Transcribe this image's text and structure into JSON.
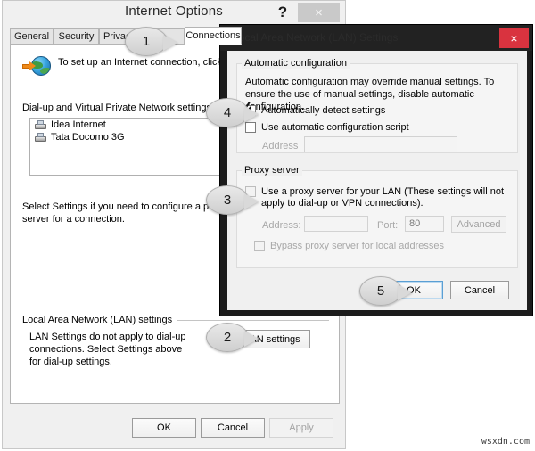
{
  "internet_options": {
    "title": "Internet Options",
    "help_icon": "?",
    "close_icon": "×",
    "tabs": [
      {
        "label": "General",
        "selected": false
      },
      {
        "label": "Security",
        "selected": false
      },
      {
        "label": "Privacy",
        "selected": false
      },
      {
        "label": "•",
        "selected": false
      },
      {
        "label": "Connections",
        "selected": true
      }
    ],
    "setup_text": "To set up an Internet connection, click Setup.",
    "dialup_group_label": "Dial-up and Virtual Private Network settings",
    "dialup_items": [
      {
        "label": "Idea Internet"
      },
      {
        "label": "Tata Docomo 3G"
      }
    ],
    "settings_hint": "Select Settings if you need to configure a proxy server for a connection.",
    "lan_group_label": "Local Area Network (LAN) settings",
    "lan_hint": "LAN Settings do not apply to dial-up connections. Select Settings above for dial-up settings.",
    "lan_settings_button": "LAN settings",
    "footer": {
      "ok": "OK",
      "cancel": "Cancel",
      "apply": "Apply",
      "apply_disabled": true
    }
  },
  "lan_dialog": {
    "title": "Local Area Network (LAN) Settings",
    "close_icon": "×",
    "auto_config": {
      "group_label": "Automatic configuration",
      "description": "Automatic configuration may override manual settings.  To ensure the use of manual settings, disable automatic configuration.",
      "auto_detect_label": "Automatically detect settings",
      "auto_detect_checked": true,
      "use_script_label": "Use automatic configuration script",
      "use_script_checked": false,
      "address_label": "Address",
      "address_value": "",
      "address_disabled": true
    },
    "proxy": {
      "group_label": "Proxy server",
      "use_proxy_label": "Use a proxy server for your LAN (These settings will not apply to dial-up or VPN connections).",
      "use_proxy_checked": false,
      "address_label": "Address:",
      "address_value": "",
      "port_label": "Port:",
      "port_value": "80",
      "advanced_button": "Advanced",
      "bypass_label": "Bypass proxy server for local addresses",
      "bypass_checked": false
    },
    "footer": {
      "ok": "OK",
      "cancel": "Cancel"
    }
  },
  "callouts": [
    {
      "number": "1"
    },
    {
      "number": "2"
    },
    {
      "number": "3"
    },
    {
      "number": "4"
    },
    {
      "number": "5"
    }
  ],
  "watermark": "wsxdn.com",
  "colors": {
    "close_red": "#d9333f",
    "dialog_dark": "#1c1c1c",
    "focus_blue": "#5a9fd4"
  }
}
